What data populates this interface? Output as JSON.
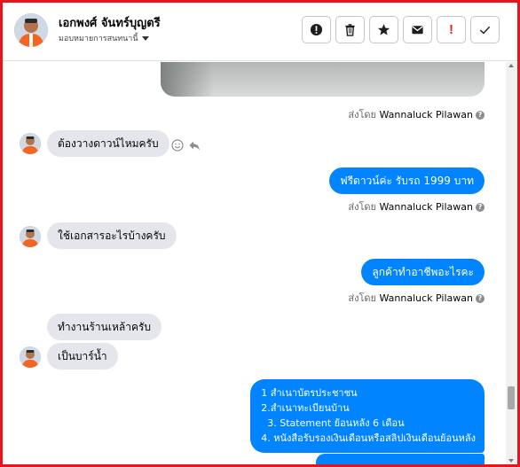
{
  "header": {
    "contact_name": "เอกพงศ์ จันทร์บุญตรี",
    "assign_label": "มอบหมายการสนทนานี้",
    "actions": [
      {
        "icon": "alert-circle-icon",
        "label": "!"
      },
      {
        "icon": "trash-icon",
        "label": ""
      },
      {
        "icon": "star-icon",
        "label": ""
      },
      {
        "icon": "envelope-icon",
        "label": ""
      },
      {
        "icon": "red-exclamation-icon",
        "label": "!"
      },
      {
        "icon": "checkmark-icon",
        "label": ""
      }
    ]
  },
  "sent_by_prefix": "ส่งโดย",
  "agent_name": "Wannaluck Pilawan",
  "messages": [
    {
      "side": "in",
      "text": "ต้องวางดาวน์ไหมครับ"
    },
    {
      "side": "out",
      "text": "ฟรีดาวน์ค่ะ รับรถ 1999 บาท"
    },
    {
      "side": "in",
      "text": "ใช้เอกสารอะไรบ้างครับ"
    },
    {
      "side": "out",
      "text": "ลูกค้าทำอาชีพอะไรคะ"
    },
    {
      "side": "in",
      "text": "ทำงานร้านเหล้าครับ"
    },
    {
      "side": "in",
      "text": "เป็นบาร์น้ำ"
    },
    {
      "side": "out",
      "lines": [
        "1 สำเนาบัตรประชาชน",
        "2.สำเนาทะเบียนบ้าน",
        "  3. Statement ย้อนหลัง 6 เดือน",
        "4. หนังสือรับรองเงินเดือนหรือสลิปเงินเดือนย้อนหลัง"
      ]
    }
  ],
  "colors": {
    "accent": "#0084ff",
    "incoming_bubble": "#e4e6eb",
    "frame": "#e8141c"
  }
}
